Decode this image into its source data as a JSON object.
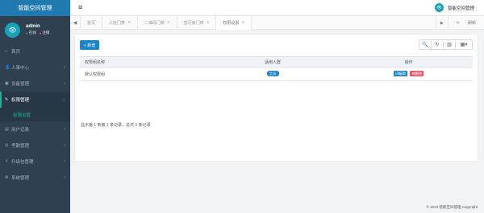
{
  "app": {
    "title": "智能空间管理"
  },
  "user": {
    "name": "admin",
    "status_online": "在线",
    "logout": "注销",
    "avatar_glyph": "👁"
  },
  "sidebar": {
    "items": [
      {
        "label": "首页",
        "icon": "home-icon",
        "glyph": "⌂",
        "has_arrow": false
      },
      {
        "label": "人事中心",
        "icon": "user-icon",
        "glyph": "👤",
        "has_arrow": true
      },
      {
        "label": "设备管理",
        "icon": "device-icon",
        "glyph": "▣",
        "has_arrow": true
      },
      {
        "label": "权限管理",
        "icon": "key-icon",
        "glyph": "✎",
        "has_arrow": true,
        "active": true
      },
      {
        "label": "用户记录",
        "icon": "list-icon",
        "glyph": "▤",
        "has_arrow": true
      },
      {
        "label": "考勤管理",
        "icon": "attendance-icon",
        "glyph": "◷",
        "has_arrow": true
      },
      {
        "label": "升级包管理",
        "icon": "upload-icon",
        "glyph": "⇪",
        "has_arrow": true
      },
      {
        "label": "系统管理",
        "icon": "gear-icon",
        "glyph": "⚙",
        "has_arrow": true
      }
    ],
    "submenu_active": "权限设置"
  },
  "topbar": {
    "menu_glyph": "≡",
    "title": "智能空间管理"
  },
  "tabs": {
    "left_glyph": "◀",
    "items": [
      {
        "label": "首页",
        "closable": false
      },
      {
        "label": "人脸门禁",
        "closable": true
      },
      {
        "label": "二维码门禁",
        "closable": true
      },
      {
        "label": "蓝牙锁门禁",
        "closable": true
      },
      {
        "label": "权限设置",
        "closable": true,
        "active": true
      }
    ],
    "right_glyph": "▶",
    "refresh_label": "刷新"
  },
  "panel": {
    "add_label": "+ 新增",
    "toolbar": [
      {
        "name": "search-icon",
        "glyph": "🔍"
      },
      {
        "name": "refresh-icon",
        "glyph": "↻"
      },
      {
        "name": "columns-icon",
        "glyph": "▥"
      },
      {
        "name": "grid-export-icon",
        "glyph": "▦▾"
      }
    ],
    "table": {
      "headers": [
        "权限组名称",
        "适用人群",
        "操作"
      ],
      "rows": [
        {
          "name": "默认权限组",
          "users": "全员",
          "edit": "☑编辑",
          "delete": "✖删除"
        }
      ]
    },
    "pagination": "显示第 1 到第 1 条记录，总共 1 条记录"
  },
  "footer": {
    "copyright": "© 2023 智能空间管理 Copyright"
  },
  "colors": {
    "sidebar_bg": "#2f4050",
    "brand": "#1f7ab0",
    "primary": "#1c84c6",
    "danger": "#ed5565",
    "accent": "#1ab394"
  }
}
